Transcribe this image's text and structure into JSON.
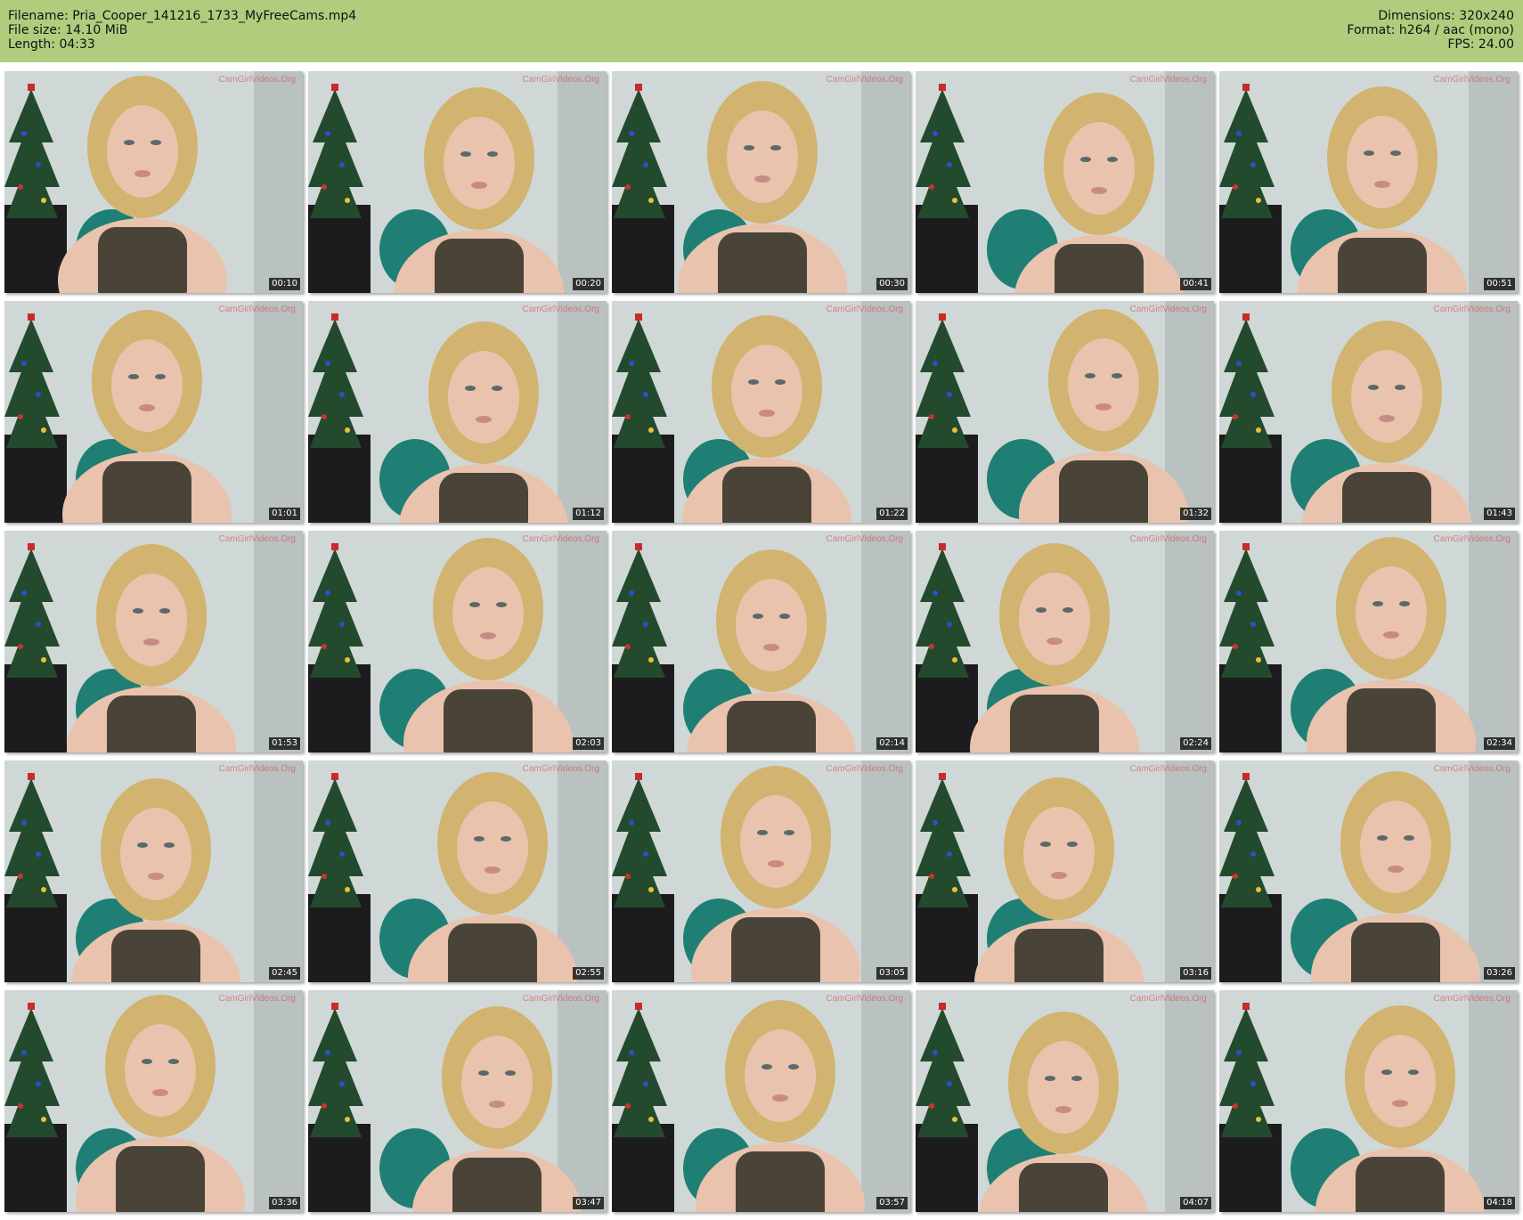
{
  "header": {
    "filename": "Filename: Pria_Cooper_141216_1733_MyFreeCams.mp4",
    "filesize": "File size: 14.10 MiB",
    "length": "Length: 04:33",
    "dimensions": "Dimensions: 320x240",
    "format": "Format: h264 / aac (mono)",
    "fps": "FPS: 24.00"
  },
  "colors": {
    "header_bg": "#b0cd7e",
    "skin": "#e9c3ad",
    "hair": "#d2b36f",
    "top": "#4a4438",
    "wall": "#cfd8d6",
    "tree": "#234a2c",
    "chair": "#1f7f74"
  },
  "watermark": "CamGirlVideos.Org",
  "thumbnails": [
    {
      "time": "00:10"
    },
    {
      "time": "00:20"
    },
    {
      "time": "00:30"
    },
    {
      "time": "00:41"
    },
    {
      "time": "00:51"
    },
    {
      "time": "01:01"
    },
    {
      "time": "01:12"
    },
    {
      "time": "01:22"
    },
    {
      "time": "01:32"
    },
    {
      "time": "01:43"
    },
    {
      "time": "01:53"
    },
    {
      "time": "02:03"
    },
    {
      "time": "02:14"
    },
    {
      "time": "02:24"
    },
    {
      "time": "02:34"
    },
    {
      "time": "02:45"
    },
    {
      "time": "02:55"
    },
    {
      "time": "03:05"
    },
    {
      "time": "03:16"
    },
    {
      "time": "03:26"
    },
    {
      "time": "03:36"
    },
    {
      "time": "03:47"
    },
    {
      "time": "03:57"
    },
    {
      "time": "04:07"
    },
    {
      "time": "04:18"
    }
  ]
}
